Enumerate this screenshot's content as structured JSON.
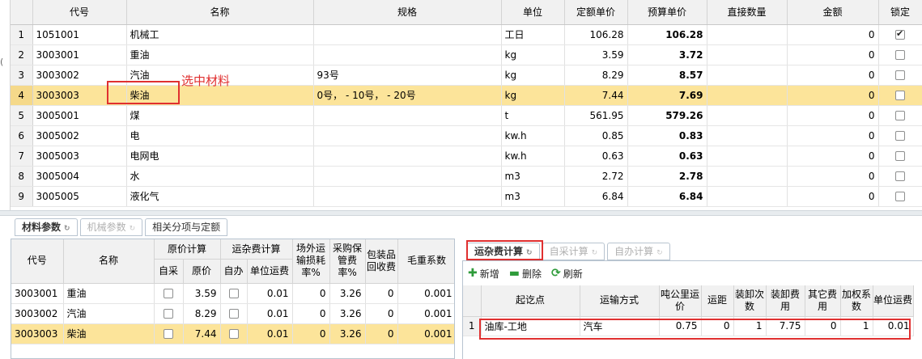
{
  "top_grid": {
    "columns": [
      "代号",
      "名称",
      "规格",
      "单位",
      "定额单价",
      "预算单价",
      "直接数量",
      "金额",
      "锁定"
    ],
    "rows": [
      {
        "n": "1",
        "code": "1051001",
        "name": "机械工",
        "spec": "",
        "unit": "工日",
        "quota": "106.28",
        "budget": "106.28",
        "qty": "",
        "amount": "0",
        "locked": true
      },
      {
        "n": "2",
        "code": "3003001",
        "name": "重油",
        "spec": "",
        "unit": "kg",
        "quota": "3.59",
        "budget": "3.72",
        "qty": "",
        "amount": "0",
        "locked": false
      },
      {
        "n": "3",
        "code": "3003002",
        "name": "汽油",
        "spec": "93号",
        "unit": "kg",
        "quota": "8.29",
        "budget": "8.57",
        "qty": "",
        "amount": "0",
        "locked": false
      },
      {
        "n": "4",
        "code": "3003003",
        "name": "柴油",
        "spec": "0号， - 10号， - 20号",
        "unit": "kg",
        "quota": "7.44",
        "budget": "7.69",
        "qty": "",
        "amount": "0",
        "locked": false,
        "selected": true
      },
      {
        "n": "5",
        "code": "3005001",
        "name": "煤",
        "spec": "",
        "unit": "t",
        "quota": "561.95",
        "budget": "579.26",
        "qty": "",
        "amount": "0",
        "locked": false
      },
      {
        "n": "6",
        "code": "3005002",
        "name": "电",
        "spec": "",
        "unit": "kw.h",
        "quota": "0.85",
        "budget": "0.83",
        "qty": "",
        "amount": "0",
        "locked": false
      },
      {
        "n": "7",
        "code": "3005003",
        "name": "电网电",
        "spec": "",
        "unit": "kw.h",
        "quota": "0.63",
        "budget": "0.63",
        "qty": "",
        "amount": "0",
        "locked": false
      },
      {
        "n": "8",
        "code": "3005004",
        "name": "水",
        "spec": "",
        "unit": "m3",
        "quota": "2.72",
        "budget": "2.78",
        "qty": "",
        "amount": "0",
        "locked": false
      },
      {
        "n": "9",
        "code": "3005005",
        "name": "液化气",
        "spec": "",
        "unit": "m3",
        "quota": "6.84",
        "budget": "6.84",
        "qty": "",
        "amount": "0",
        "locked": false
      }
    ]
  },
  "annotation": {
    "label": "选中材料",
    "color": "#e03030"
  },
  "left_tabs": [
    {
      "label": "材料参数",
      "icon": "refresh-icon",
      "state": "active"
    },
    {
      "label": "机械参数",
      "icon": "refresh-icon",
      "state": "disabled"
    },
    {
      "label": "相关分项与定额",
      "state": "normal"
    }
  ],
  "left_grid": {
    "headers": {
      "code": "代号",
      "name": "名称",
      "orig": "原价计算",
      "self": "自采",
      "price": "原价",
      "freight": "运杂费计算",
      "selfdo": "自办",
      "unitfreight": "单位运费",
      "loss": "场外运输损耗率%",
      "keep": "采购保管费率%",
      "pack": "包装品回收费",
      "gross": "毛重系数"
    },
    "rows": [
      {
        "code": "3003001",
        "name": "重油",
        "self": false,
        "price": "3.59",
        "selfdo": false,
        "unitfreight": "0.01",
        "loss": "0",
        "keep": "3.26",
        "pack": "0",
        "gross": "0.001"
      },
      {
        "code": "3003002",
        "name": "汽油",
        "self": false,
        "price": "8.29",
        "selfdo": false,
        "unitfreight": "0.01",
        "loss": "0",
        "keep": "3.26",
        "pack": "0",
        "gross": "0.001"
      },
      {
        "code": "3003003",
        "name": "柴油",
        "self": false,
        "price": "7.44",
        "selfdo": false,
        "unitfreight": "0.01",
        "loss": "0",
        "keep": "3.26",
        "pack": "0",
        "gross": "0.001",
        "selected": true
      }
    ]
  },
  "right_tabs": [
    {
      "label": "运杂费计算",
      "icon": "refresh-icon",
      "state": "active"
    },
    {
      "label": "自采计算",
      "icon": "refresh-icon",
      "state": "disabled"
    },
    {
      "label": "自办计算",
      "icon": "refresh-icon",
      "state": "disabled"
    }
  ],
  "toolbar": {
    "add": "新增",
    "add_icon": "plus-icon",
    "add_color": "#2e9b3a",
    "delete": "删除",
    "delete_icon": "minus-icon",
    "delete_color": "#2e9b3a",
    "refresh": "刷新",
    "refresh_icon": "refresh-icon",
    "refresh_color": "#2e9b3a"
  },
  "right_grid": {
    "headers": {
      "route": "起讫点",
      "mode": "运输方式",
      "tonkm": "吨公里运价",
      "dist": "运距",
      "times": "装卸次数",
      "loadcost": "装卸费用",
      "other": "其它费用",
      "weight": "加权系数",
      "unitfreight": "单位运费"
    },
    "rows": [
      {
        "n": "1",
        "route": "油库-工地",
        "mode": "汽车",
        "tonkm": "0.75",
        "dist": "0",
        "times": "1",
        "loadcost": "7.75",
        "other": "0",
        "weight": "1",
        "unitfreight": "0.01"
      }
    ]
  },
  "stub_text": "(",
  "colors": {
    "selected_row": "#fce49a",
    "highlight_red": "#e03030",
    "header_bg": "#f1f1f1"
  }
}
